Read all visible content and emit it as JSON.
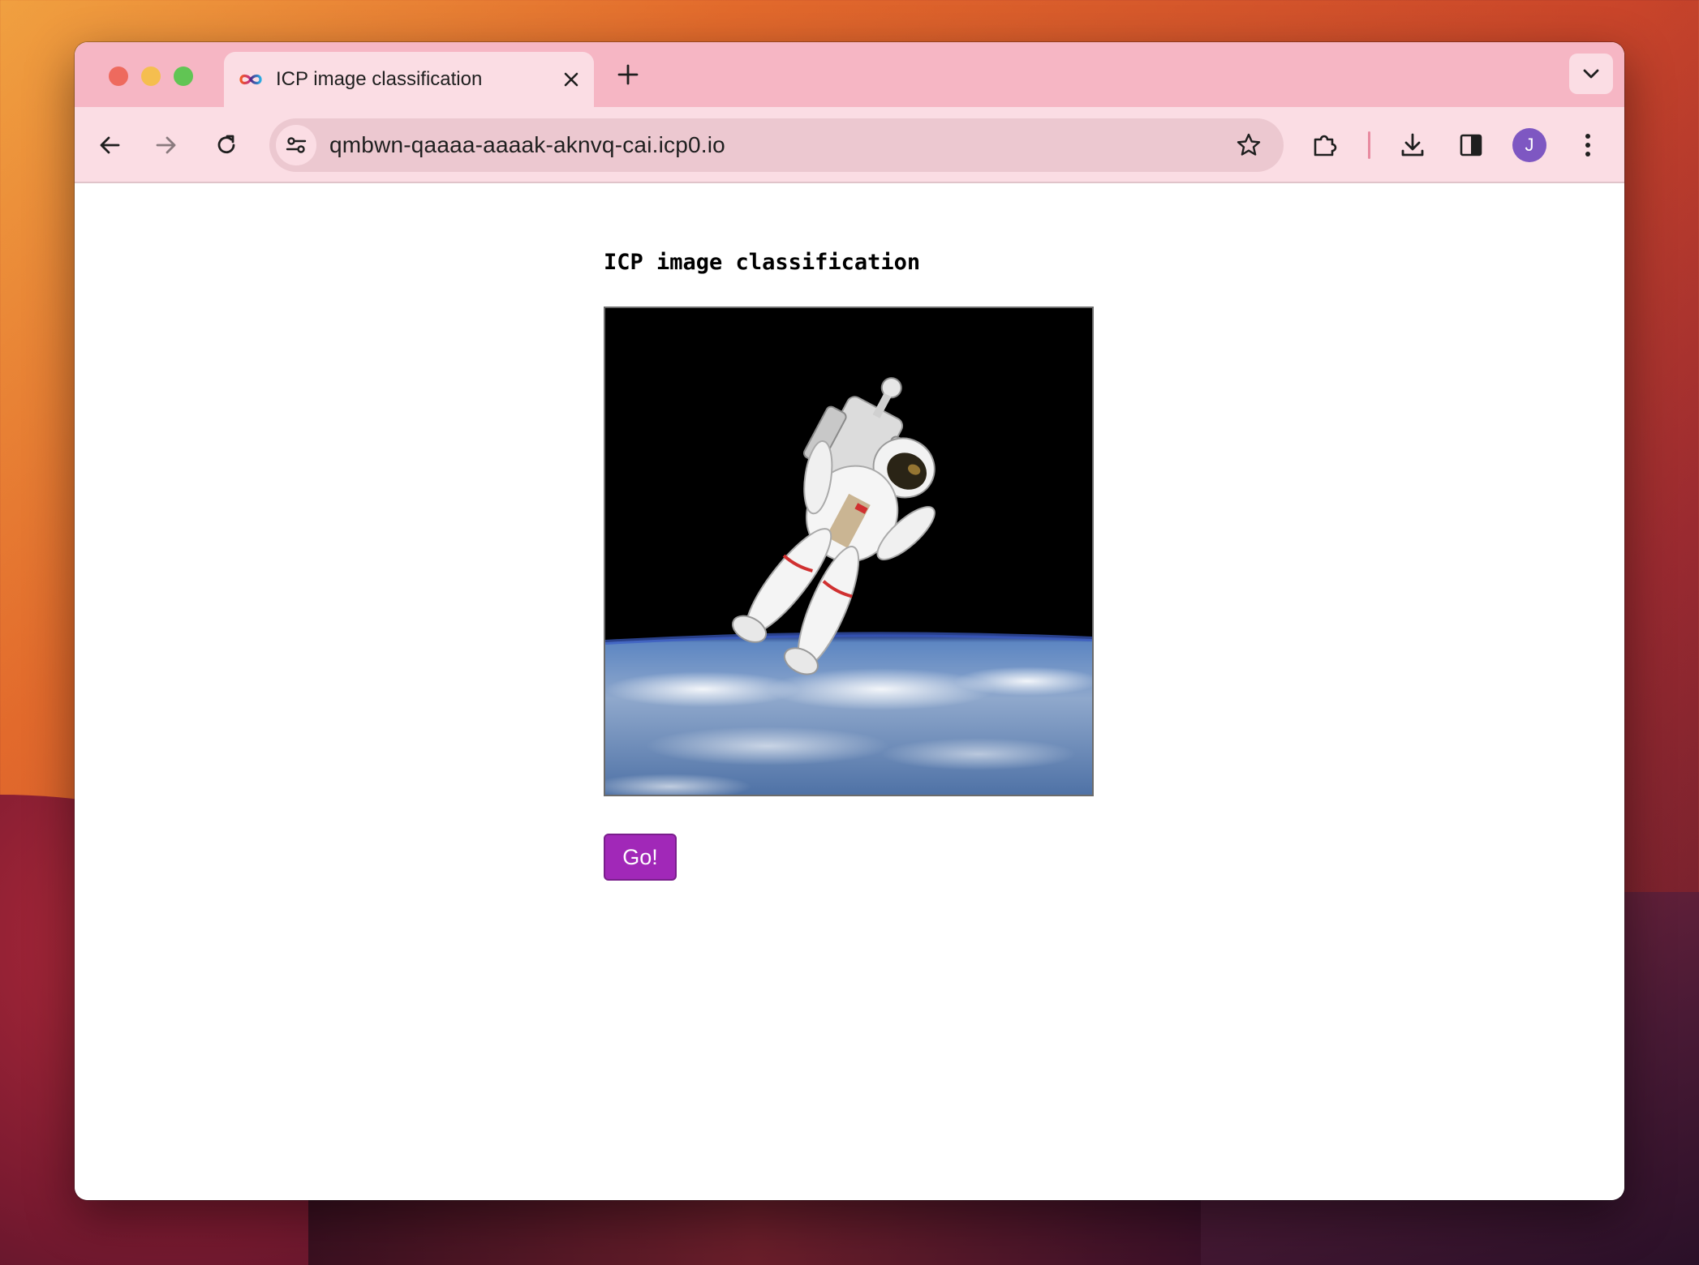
{
  "browser": {
    "tab": {
      "title": "ICP image classification"
    },
    "address_bar": {
      "url": "qmbwn-qaaaa-aaaak-aknvq-cai.icp0.io"
    },
    "profile": {
      "initial": "J",
      "color": "#7e57c2"
    },
    "icons": [
      "infinity-logo-icon",
      "close-icon",
      "plus-icon",
      "chevron-down-icon",
      "back-arrow-icon",
      "forward-arrow-icon",
      "reload-icon",
      "tune-icon",
      "star-icon",
      "puzzle-icon",
      "download-icon",
      "side-panel-icon",
      "more-vert-icon"
    ],
    "colors": {
      "tabbar": "#f6b6c4",
      "toolbar": "#fbdde4"
    }
  },
  "page": {
    "title": "ICP image classification",
    "image_subject": "astronaut",
    "go_button": {
      "label": "Go!",
      "color": "#a128b8"
    }
  }
}
